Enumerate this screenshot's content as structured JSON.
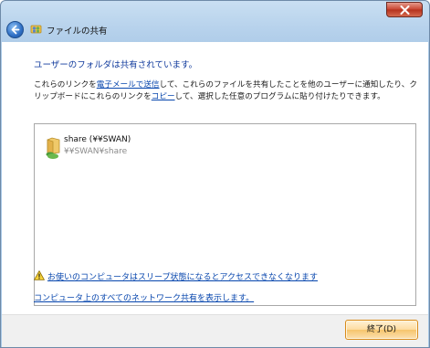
{
  "window": {
    "title": "ファイルの共有",
    "accent": "#c8432f"
  },
  "content": {
    "heading": "ユーザーのフォルダは共有されています。",
    "description": {
      "part1": "これらのリンクを",
      "email_link": "電子メールで送信",
      "part2": "して、これらのファイルを共有したことを他のユーザーに通知したり、クリップボードにこれらのリンクを",
      "copy_link": "コピー",
      "part3": "して、選択した任意のプログラムに貼り付けたりできます。"
    },
    "shares": [
      {
        "name": "share (¥¥SWAN)",
        "path": "¥¥SWAN¥share"
      }
    ],
    "sleep_warning_link": "お使いのコンピュータはスリープ状態になるとアクセスできなくなります",
    "all_shares_link": "コンピュータ上のすべてのネットワーク共有を表示します。"
  },
  "footer": {
    "finish_label": "終了(D)"
  }
}
